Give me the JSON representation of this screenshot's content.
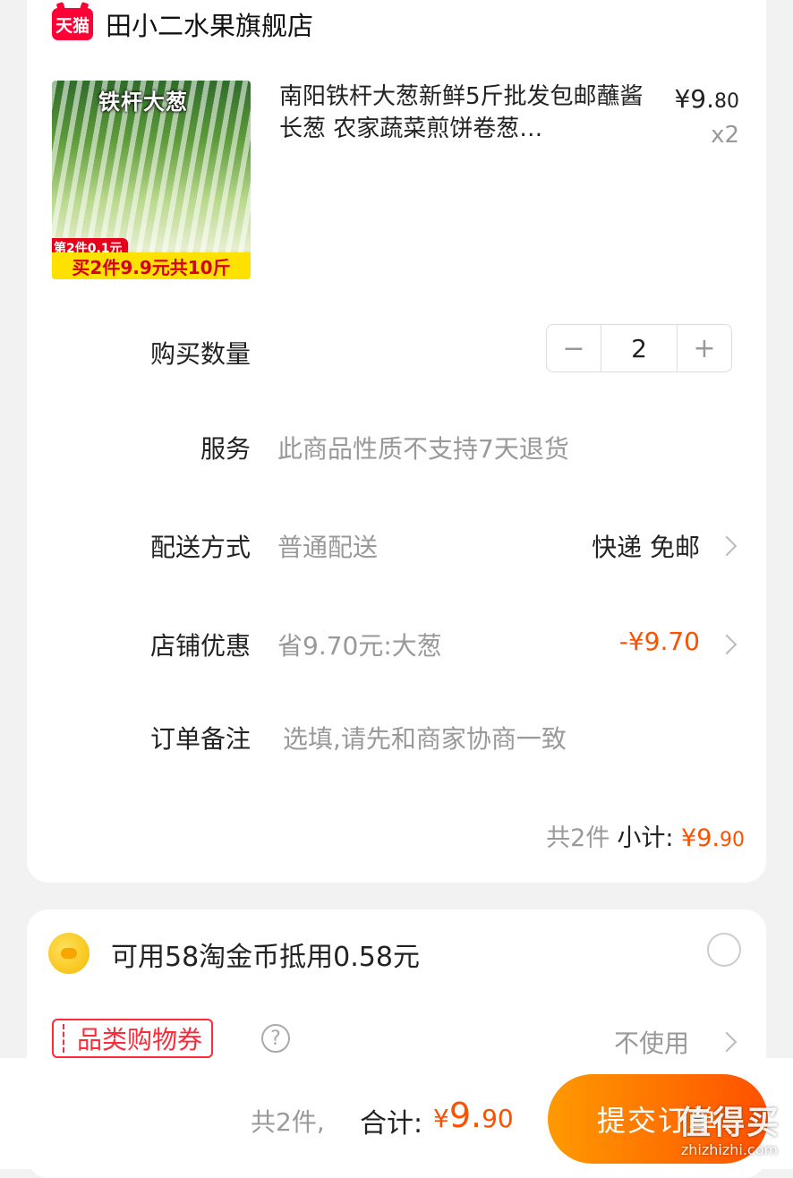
{
  "shop": {
    "badge": "天猫",
    "name": "田小二水果旗舰店"
  },
  "product": {
    "image_title": "铁杆大葱",
    "image_sub": "第2件0.1元",
    "image_bottom": "买2件9.9元共10斤",
    "title": "南阳铁杆大葱新鲜5斤批发包邮蘸酱长葱 农家蔬菜煎饼卷葱…",
    "price_main": "¥9.",
    "price_cents": "80",
    "quantity_label": "x2"
  },
  "quantity": {
    "label": "购买数量",
    "minus": "−",
    "value": "2",
    "plus": "+"
  },
  "service": {
    "label": "服务",
    "value": "此商品性质不支持7天退货"
  },
  "delivery": {
    "label": "配送方式",
    "value": "普通配送",
    "right": "快递 免邮"
  },
  "shop_discount": {
    "label": "店铺优惠",
    "value": "省9.70元:大葱",
    "amount": "-¥9.70",
    "amount_color": "#ff5000"
  },
  "remark": {
    "label": "订单备注",
    "placeholder": "选填,请先和商家协商一致"
  },
  "subtotal": {
    "count": "共2件",
    "label": "小计:",
    "amount_main": "¥9.",
    "amount_cents": "90"
  },
  "coins": {
    "text": "可用58淘金币抵用0.58元"
  },
  "coupon": {
    "tag": "品类购物券",
    "help": "?",
    "value": "不使用"
  },
  "footer": {
    "count": "共2件,",
    "label": "合计:",
    "yen": "¥",
    "amount_main": "9.",
    "amount_cents": "90",
    "submit": "提交订单",
    "watermark_main": "值得买",
    "watermark_sub": "zhizhizhi.com"
  },
  "colors": {
    "accent": "#ff5000",
    "tmall_red": "#ff0036",
    "coupon_red": "#ff2b3a"
  }
}
